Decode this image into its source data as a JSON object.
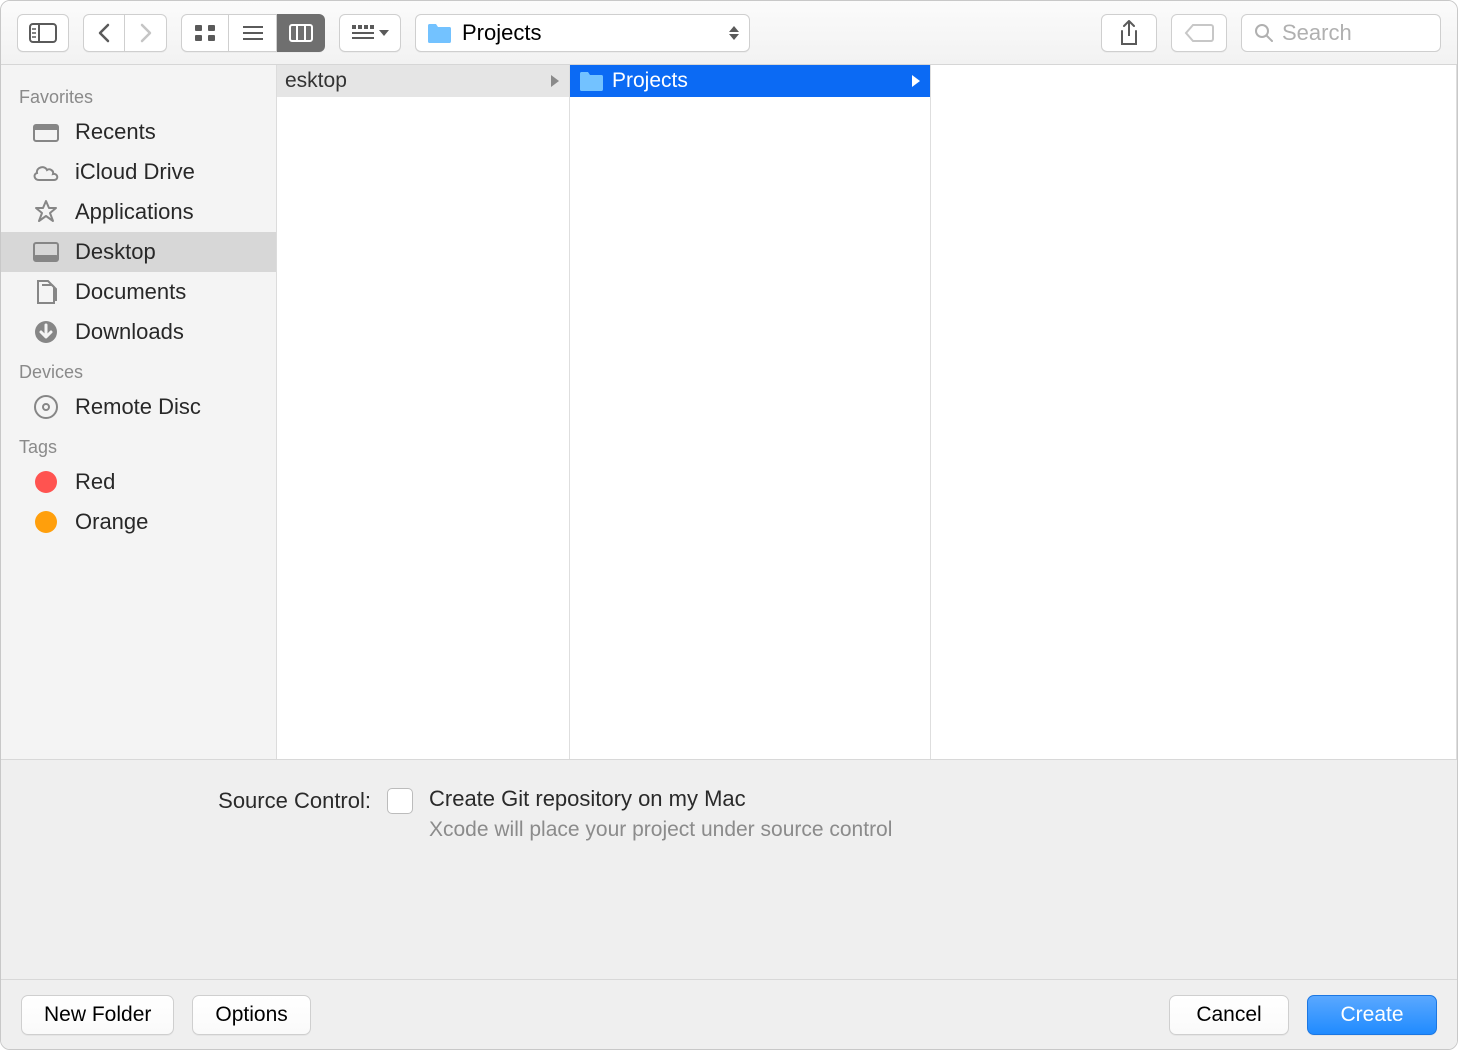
{
  "location": {
    "folder_name": "Projects"
  },
  "search": {
    "placeholder": "Search"
  },
  "sidebar": {
    "sections": [
      {
        "title": "Favorites",
        "items": [
          {
            "label": "Recents",
            "icon": "recents",
            "selected": false
          },
          {
            "label": "iCloud Drive",
            "icon": "icloud",
            "selected": false
          },
          {
            "label": "Applications",
            "icon": "applications",
            "selected": false
          },
          {
            "label": "Desktop",
            "icon": "desktop",
            "selected": true
          },
          {
            "label": "Documents",
            "icon": "documents",
            "selected": false
          },
          {
            "label": "Downloads",
            "icon": "downloads",
            "selected": false
          }
        ]
      },
      {
        "title": "Devices",
        "items": [
          {
            "label": "Remote Disc",
            "icon": "remote-disc",
            "selected": false
          }
        ]
      },
      {
        "title": "Tags",
        "items": [
          {
            "label": "Red",
            "icon": "tag-red",
            "selected": false
          },
          {
            "label": "Orange",
            "icon": "tag-orange",
            "selected": false
          }
        ]
      }
    ]
  },
  "columns": {
    "col0": {
      "label": "esktop",
      "truncated": true,
      "selected": "dim"
    },
    "col1": {
      "label": "Projects",
      "selected": "sel"
    }
  },
  "options": {
    "label": "Source Control:",
    "checkbox_label": "Create Git repository on my Mac",
    "help_text": "Xcode will place your project under source control"
  },
  "buttons": {
    "new_folder": "New Folder",
    "options": "Options",
    "cancel": "Cancel",
    "create": "Create"
  }
}
